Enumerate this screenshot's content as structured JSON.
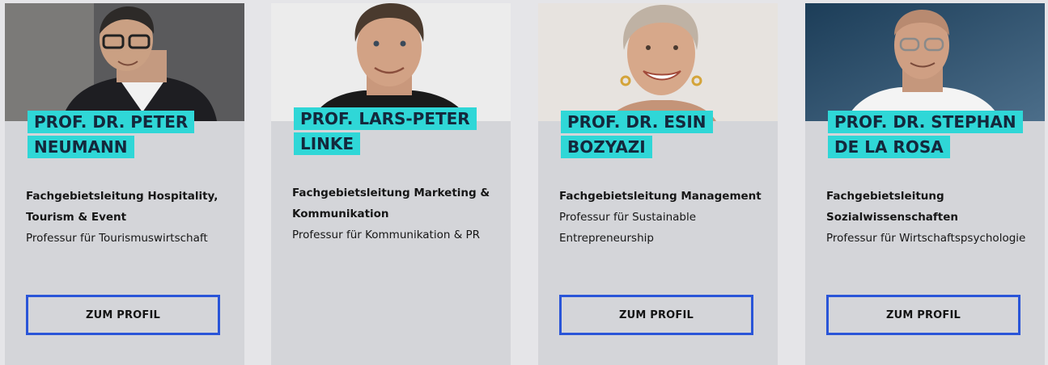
{
  "profiles": [
    {
      "name_line1": "PROF. DR. PETER",
      "name_line2": "NEUMANN",
      "role": "Fachgebietsleitung Hospitality, Tourism & Event",
      "title": "Professur für Tourismuswirtschaft",
      "button": "ZUM PROFIL"
    },
    {
      "name_line1": "PROF. LARS-PETER",
      "name_line2": "LINKE",
      "role": "Fachgebietsleitung Marketing & Kommunikation",
      "title": "Professur für Kommunikation & PR",
      "button": ""
    },
    {
      "name_line1": "PROF. DR. ESIN",
      "name_line2": "BOZYAZI",
      "role": "Fachgebietsleitung Management",
      "title": "Professur für Sustainable Entrepreneurship",
      "button": "ZUM PROFIL"
    },
    {
      "name_line1": "PROF. DR. STEPHAN",
      "name_line2": "DE LA ROSA",
      "role": "Fachgebietsleitung Sozialwissenschaften",
      "title": "Professur für Wirtschaftspsychologie",
      "button": "ZUM PROFIL"
    }
  ],
  "colors": {
    "name_highlight": "#2fd7d7",
    "card_bg": "#d4d5d9",
    "button_border": "#2a55d8"
  }
}
